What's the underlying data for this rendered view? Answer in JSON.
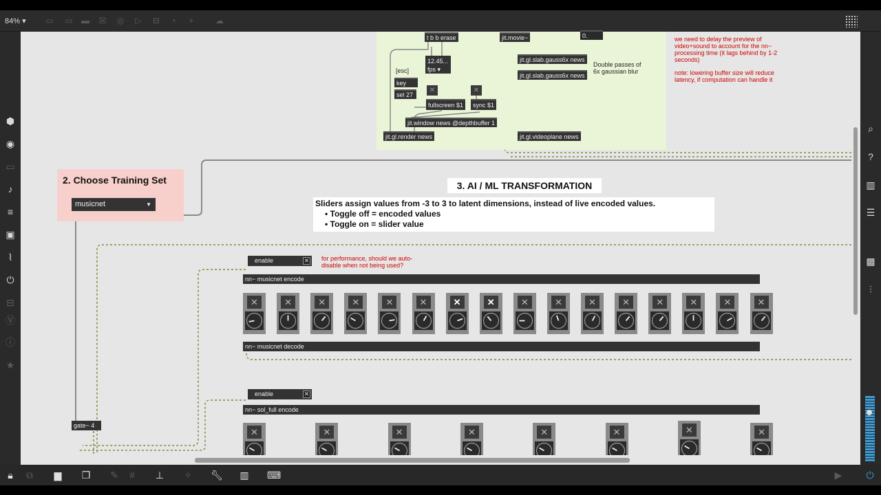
{
  "toolbar": {
    "zoom": "84%"
  },
  "green_panel": {
    "tbb": "t b b erase",
    "jitmovie": "jit.movie~",
    "zero": "0.",
    "fps_value": "12.45...",
    "fps_unit": "fps",
    "esc_label": "[esc]",
    "key": "key",
    "sel27": "sel 27",
    "fullscreen": "fullscreen $1",
    "sync": "sync $1",
    "window": "jit.window news @depthbuffer 1",
    "render": "jit.gl.render news",
    "gauss1": "jit.gl.slab.gauss6x news",
    "gauss2": "jit.gl.slab.gauss6x news",
    "videoplane": "jit.gl.videoplane news",
    "double_passes": "Double passes of 6x gaussian blur"
  },
  "notes": {
    "delay": "we need to delay the preview of video+sound to account for the nn~ processing time (it lags behind by 1-2 seconds)",
    "lowering": "note: lowering buffer size will reduce latency, if computation can handle it",
    "performance": "for performance, should we auto-disable when not being used?"
  },
  "training": {
    "title": "2. Choose Training Set",
    "selected": "musicnet"
  },
  "transformation": {
    "title": "3. AI / ML TRANSFORMATION",
    "description": "Sliders assign values from -3 to 3 to latent dimensions, instead of live encoded values.",
    "bullet1": "• Toggle off = encoded values",
    "bullet2": "• Toggle on = slider value"
  },
  "musicnet": {
    "enable": "enable",
    "encode": "nn~ musicnet encode",
    "decode": "nn~ musicnet decode",
    "toggles_on": [
      false,
      false,
      false,
      false,
      false,
      false,
      true,
      true,
      false,
      false,
      false,
      false,
      false,
      false,
      false,
      false
    ],
    "dial_angles_deg": [
      -100,
      0,
      40,
      -60,
      80,
      30,
      70,
      -40,
      -90,
      -20,
      30,
      40,
      40,
      0,
      60,
      40
    ]
  },
  "solfull": {
    "enable": "enable",
    "encode": "nn~ sol_full encode",
    "gate": "gate~ 4"
  }
}
